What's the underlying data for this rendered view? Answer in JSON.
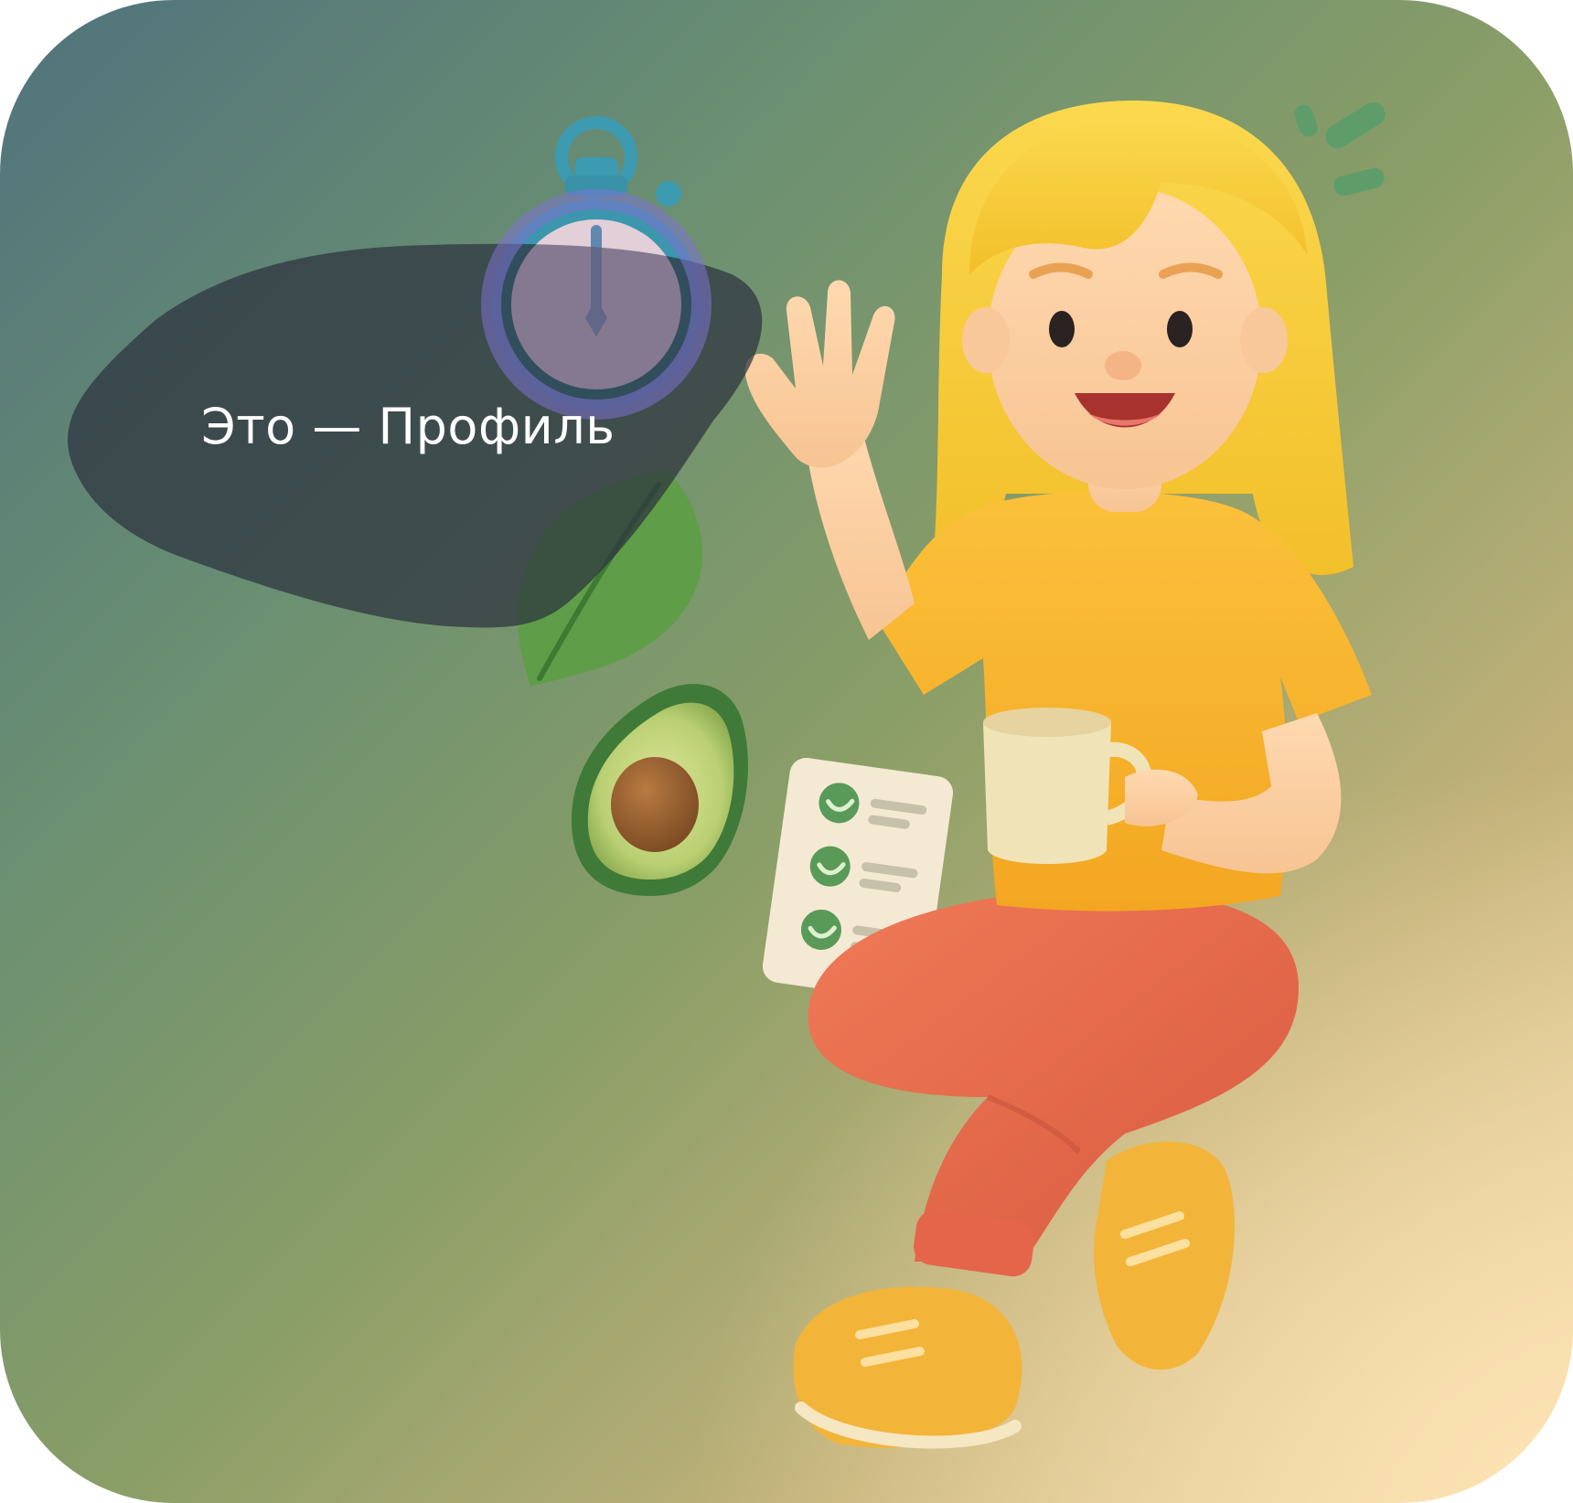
{
  "onboarding": {
    "tooltip_text": "Это — Профиль"
  },
  "colors": {
    "tooltip_background": "#2e3440",
    "shirt": "#f7b62c",
    "pants": "#e8684a",
    "hair": "#f8cf3d",
    "sneakers": "#f3b43a"
  },
  "icons": [
    "stopwatch-icon",
    "leaf-icon",
    "avocado-icon",
    "checklist-icon",
    "coffee-mug-icon"
  ]
}
